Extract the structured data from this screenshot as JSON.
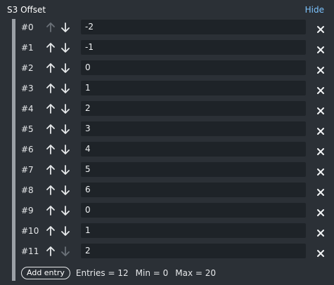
{
  "header": {
    "title": "S3 Offset",
    "hide_label": "Hide"
  },
  "entries": [
    {
      "index": "#0",
      "value": "-2",
      "up_enabled": false,
      "down_enabled": true
    },
    {
      "index": "#1",
      "value": "-1",
      "up_enabled": true,
      "down_enabled": true
    },
    {
      "index": "#2",
      "value": "0",
      "up_enabled": true,
      "down_enabled": true
    },
    {
      "index": "#3",
      "value": "1",
      "up_enabled": true,
      "down_enabled": true
    },
    {
      "index": "#4",
      "value": "2",
      "up_enabled": true,
      "down_enabled": true
    },
    {
      "index": "#5",
      "value": "3",
      "up_enabled": true,
      "down_enabled": true
    },
    {
      "index": "#6",
      "value": "4",
      "up_enabled": true,
      "down_enabled": true
    },
    {
      "index": "#7",
      "value": "5",
      "up_enabled": true,
      "down_enabled": true
    },
    {
      "index": "#8",
      "value": "6",
      "up_enabled": true,
      "down_enabled": true
    },
    {
      "index": "#9",
      "value": "0",
      "up_enabled": true,
      "down_enabled": true
    },
    {
      "index": "#10",
      "value": "1",
      "up_enabled": true,
      "down_enabled": true
    },
    {
      "index": "#11",
      "value": "2",
      "up_enabled": true,
      "down_enabled": false
    }
  ],
  "footer": {
    "add_label": "Add entry",
    "entries_text": "Entries = 12",
    "min_text": "Min = 0",
    "max_text": "Max = 20"
  },
  "colors": {
    "background": "#2b3036",
    "field": "#1e2328",
    "accent_link": "#7dc4ff",
    "arrow_enabled": "#e6e8ea",
    "arrow_disabled": "#6b7178"
  },
  "icons": {
    "up": "arrow-up-icon",
    "down": "arrow-down-icon",
    "remove": "close-icon"
  }
}
